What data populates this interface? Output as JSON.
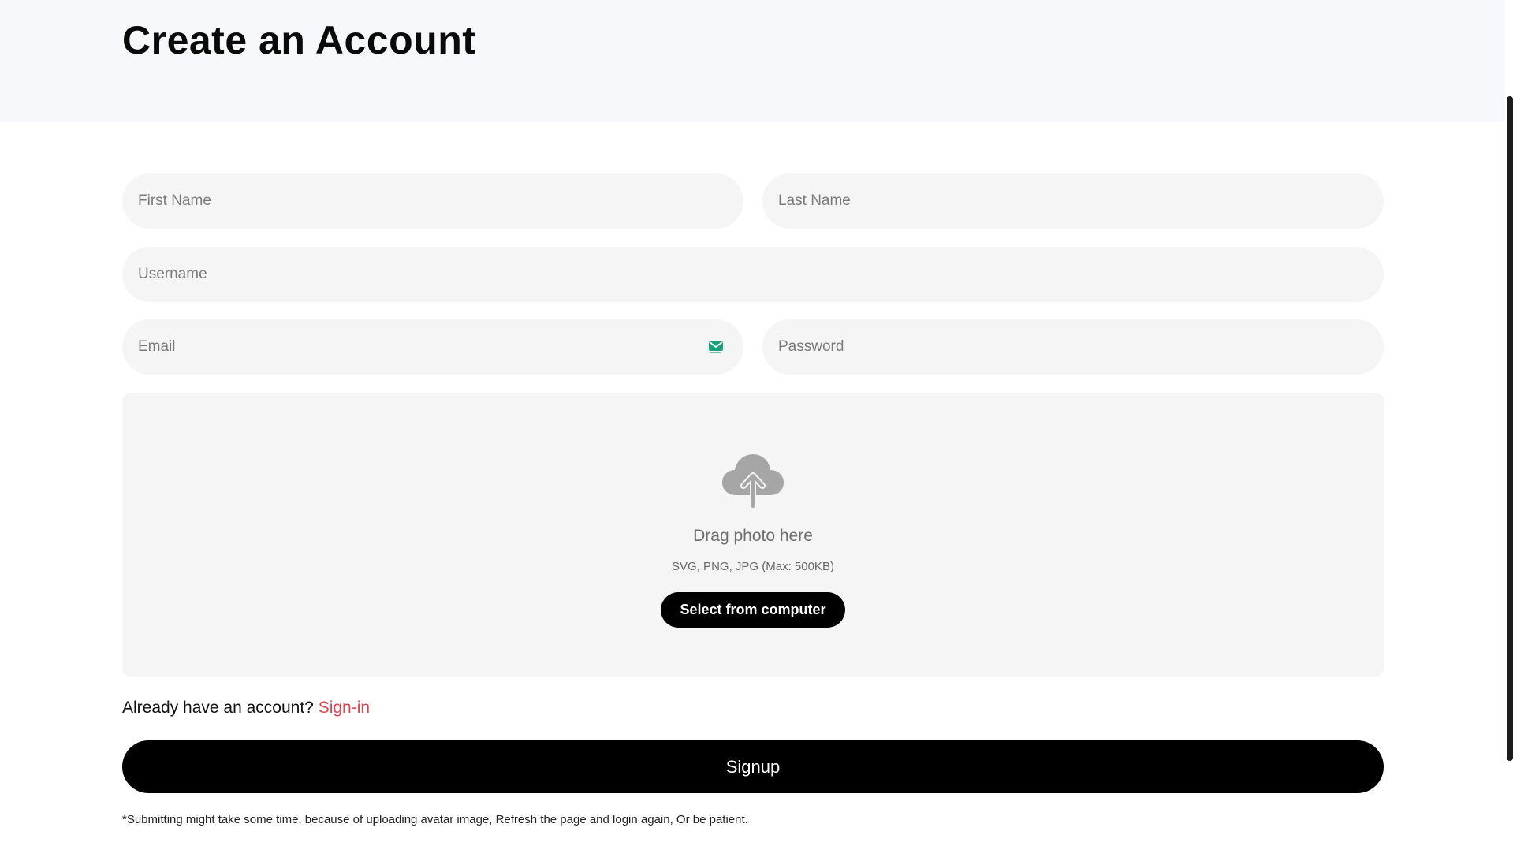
{
  "page": {
    "title": "Create an Account"
  },
  "form": {
    "first_name_placeholder": "First Name",
    "last_name_placeholder": "Last Name",
    "username_placeholder": "Username",
    "email_placeholder": "Email",
    "password_placeholder": "Password",
    "email_icon": "email-badge-icon"
  },
  "upload": {
    "icon": "cloud-upload-icon",
    "drag_text": "Drag photo here",
    "formats_text": "SVG, PNG, JPG (Max: 500KB)",
    "select_button_label": "Select from computer"
  },
  "signin": {
    "prompt": "Already have an account?",
    "link_label": "Sign-in"
  },
  "signup_button_label": "Signup",
  "footnote": "*Submitting might take some time, because of uploading avatar image, Refresh the page and login again, Or be patient.",
  "colors": {
    "accent_link": "#e0464f",
    "email_icon_green": "#1aa179",
    "primary_button": "#000000",
    "field_background": "#f5f5f5",
    "header_background": "#f7f8fc"
  }
}
